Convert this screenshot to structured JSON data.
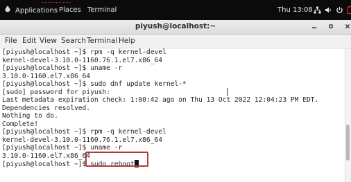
{
  "topbar": {
    "applications": "Applications",
    "places": "Places",
    "terminal": "Terminal",
    "clock": "Thu 13:08",
    "icons": [
      "network-icon",
      "volume-icon",
      "power-icon",
      "battery-icon"
    ]
  },
  "window": {
    "title": "piyush@localhost:~",
    "controls": [
      "minimize",
      "maximize",
      "close"
    ]
  },
  "menubar": {
    "items": [
      "File",
      "Edit",
      "View",
      "Search",
      "Terminal",
      "Help"
    ]
  },
  "terminal": {
    "lines": [
      "[piyush@localhost ~]$ rpm -q kernel-devel",
      "kernel-devel-3.10.0-1160.76.1.el7.x86_64",
      "[piyush@localhost ~]$ uname -r",
      "3.10.0-1160.el7.x86_64",
      "[piyush@localhost ~]$ sudo dnf update kernel-*",
      "[sudo] password for piyush:",
      "Last metadata expiration check: 1:00:42 ago on Thu 13 Oct 2022 12:04:23 PM EDT.",
      "Dependencies resolved.",
      "Nothing to do.",
      "Complete!",
      "[piyush@localhost ~]$ rpm -q kernel-devel",
      "kernel-devel-3.10.0-1160.76.1.el7.x86_64",
      "[piyush@localhost ~]$ uname -r",
      "3.10.0-1160.el7.x86_64"
    ],
    "prompt": "[piyush@localhost ~]$ ",
    "current_input": "sudo reboot"
  },
  "colors": {
    "topbar_bg": "#0b0b0b",
    "highlight_border": "#b33a3a"
  }
}
